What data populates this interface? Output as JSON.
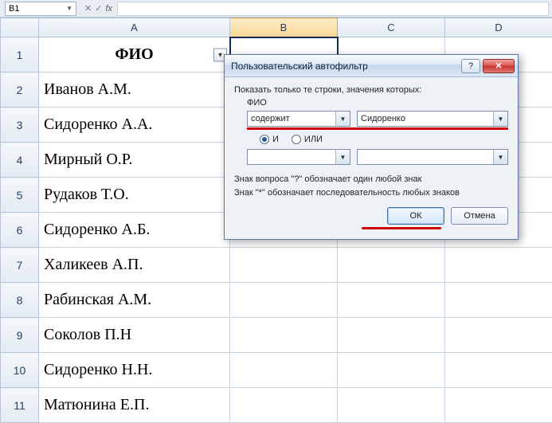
{
  "formula_bar": {
    "name_box": "B1",
    "fx_label": "fx",
    "formula_value": ""
  },
  "columns": [
    "A",
    "B",
    "C",
    "D"
  ],
  "selected_column": "B",
  "active_cell": "B1",
  "header_row": {
    "label": "ФИО",
    "has_filter": true
  },
  "rows": [
    {
      "num": 1,
      "A": "ФИО"
    },
    {
      "num": 2,
      "A": "Иванов А.М."
    },
    {
      "num": 3,
      "A": "Сидоренко А.А."
    },
    {
      "num": 4,
      "A": "Мирный О.Р."
    },
    {
      "num": 5,
      "A": "Рудаков Т.О."
    },
    {
      "num": 6,
      "A": "Сидоренко А.Б."
    },
    {
      "num": 7,
      "A": "Халикеев А.П."
    },
    {
      "num": 8,
      "A": "Рабинская А.М."
    },
    {
      "num": 9,
      "A": "Соколов П.Н"
    },
    {
      "num": 10,
      "A": "Сидоренко Н.Н."
    },
    {
      "num": 11,
      "A": "Матюнина Е.П."
    }
  ],
  "dialog": {
    "title": "Пользовательский автофильтр",
    "show_rows_label": "Показать только те строки, значения которых:",
    "field_name": "ФИО",
    "criteria": [
      {
        "operator": "содержит",
        "value": "Сидоренко"
      },
      {
        "operator": "",
        "value": ""
      }
    ],
    "logic": {
      "and_label": "И",
      "or_label": "ИЛИ",
      "selected": "and"
    },
    "hint1": "Знак вопроса \"?\" обозначает один любой знак",
    "hint2": "Знак \"*\" обозначает последовательность любых знаков",
    "ok_label": "ОК",
    "cancel_label": "Отмена",
    "help_symbol": "?",
    "close_symbol": "✕"
  }
}
